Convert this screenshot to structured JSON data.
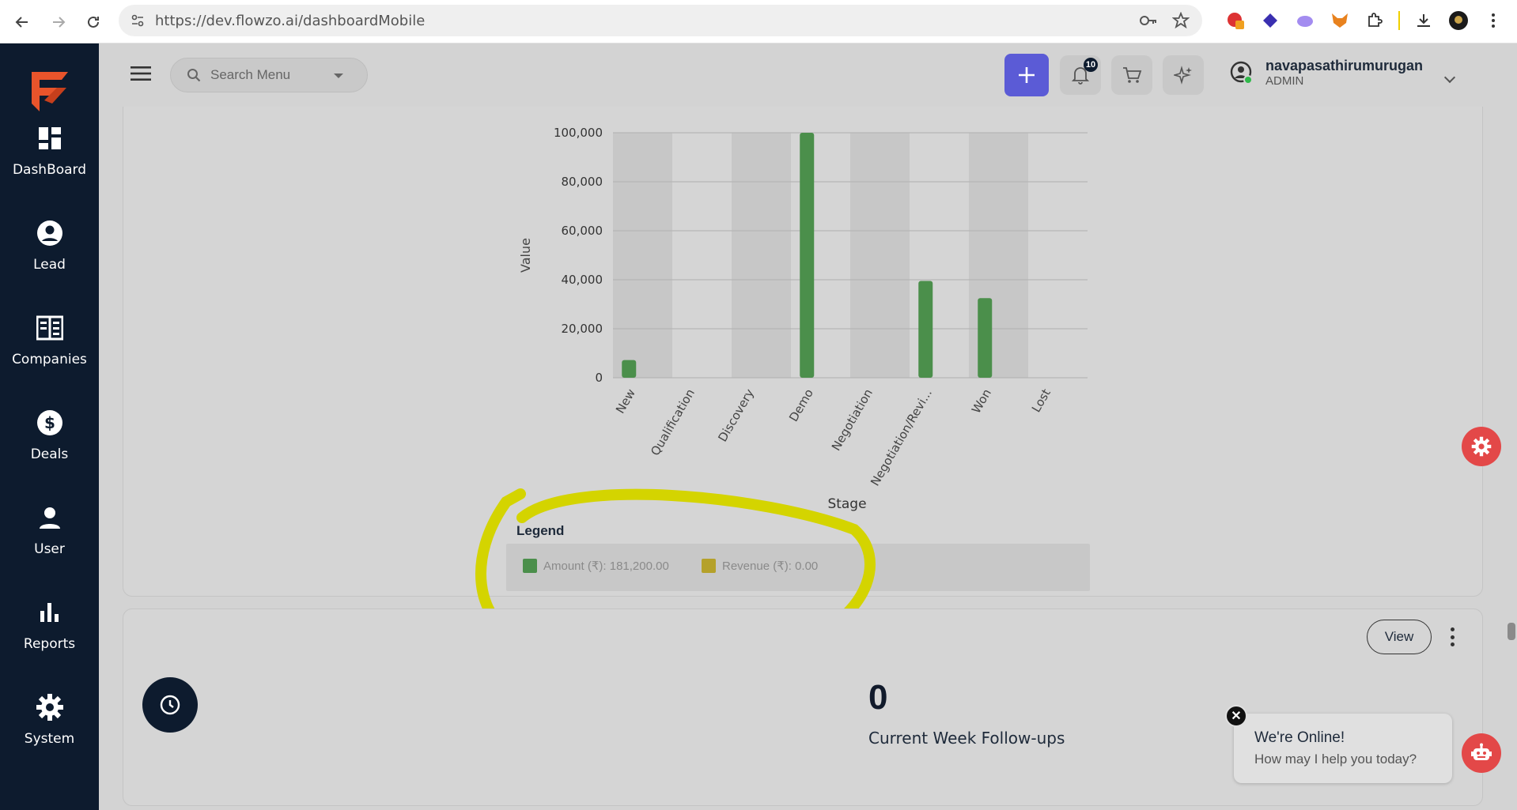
{
  "browser": {
    "url": "https://dev.flowzo.ai/dashboardMobile"
  },
  "sidebar": {
    "items": [
      {
        "label": "DashBoard",
        "icon": "dashboard-icon"
      },
      {
        "label": "Lead",
        "icon": "account-circle-icon"
      },
      {
        "label": "Companies",
        "icon": "building-icon"
      },
      {
        "label": "Deals",
        "icon": "dollar-icon"
      },
      {
        "label": "User",
        "icon": "person-icon"
      },
      {
        "label": "Reports",
        "icon": "bar-chart-icon"
      },
      {
        "label": "System",
        "icon": "gear-icon"
      }
    ]
  },
  "header": {
    "search_placeholder": "Search Menu",
    "notification_count": "10",
    "user_name": "navapasathirumurugan",
    "user_role": "ADMIN"
  },
  "chart_data": {
    "type": "bar",
    "categories": [
      "New",
      "Qualification",
      "Discovery",
      "Demo",
      "Negotiation",
      "Negotiation/Revi...",
      "Won",
      "Lost"
    ],
    "series": [
      {
        "name": "Amount (₹)",
        "values": [
          7200,
          0,
          0,
          100000,
          0,
          39500,
          32500,
          0
        ]
      }
    ],
    "xlabel": "Stage",
    "ylabel": "Value",
    "ylim": [
      0,
      100000
    ],
    "yticks": [
      "0",
      "20,000",
      "40,000",
      "60,000",
      "80,000",
      "100,000"
    ],
    "colors": {
      "bar": "#4b8f4b",
      "band": "#c7c7c7"
    }
  },
  "legend": {
    "title": "Legend",
    "items": [
      {
        "label": "Amount (₹): 181,200.00",
        "color": "#4b8f4b"
      },
      {
        "label": "Revenue (₹): 0.00",
        "color": "#b5a12a"
      }
    ]
  },
  "followups": {
    "view_label": "View",
    "count": "0",
    "label": "Current Week Follow-ups"
  },
  "chat": {
    "title": "We're Online!",
    "subtitle": "How may I help you today?"
  },
  "colors": {
    "sidebar_bg": "#0d1b2e",
    "accent": "#5b5bd6",
    "highlight": "#d4d400",
    "floating_red": "#e34848"
  }
}
